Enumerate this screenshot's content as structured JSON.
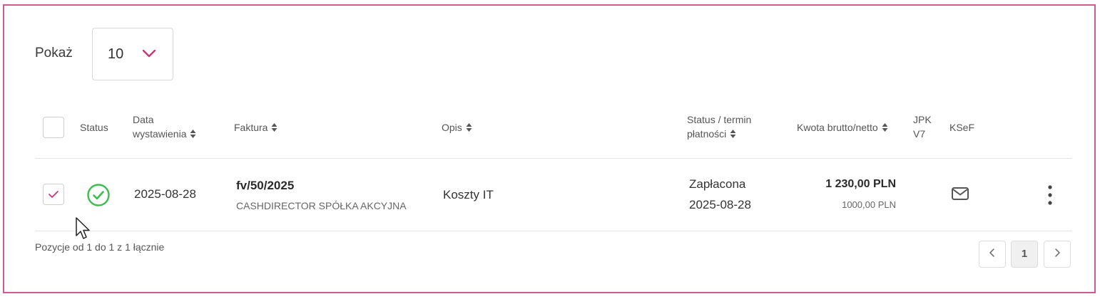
{
  "toolbar": {
    "show_label": "Pokaż",
    "page_size_value": "10"
  },
  "table": {
    "headers": {
      "status": "Status",
      "issue_date_line1": "Data",
      "issue_date_line2": "wystawienia",
      "invoice": "Faktura",
      "description": "Opis",
      "payment_status_line1": "Status / termin",
      "payment_status_line2": "płatności",
      "amount": "Kwota brutto/netto",
      "jpk_line1": "JPK",
      "jpk_line2": "V7",
      "ksef": "KSeF"
    },
    "rows": [
      {
        "checked": true,
        "status_icon": "check-circle-icon",
        "issue_date": "2025-08-28",
        "invoice_number": "fv/50/2025",
        "client": "CASHDIRECTOR SPÓŁKA AKCYJNA",
        "description": "Koszty IT",
        "payment_status": "Zapłacona",
        "payment_date": "2025-08-28",
        "amount_gross": "1 230,00 PLN",
        "amount_net": "1000,00 PLN",
        "ksef_icon": "envelope-icon",
        "actions_icon": "more-vertical-icon"
      }
    ]
  },
  "footer": {
    "summary": "Pozycje od 1 do 1 z 1 łącznie"
  },
  "pagination": {
    "prev_icon": "chevron-left-icon",
    "current_page": "1",
    "next_icon": "chevron-right-icon"
  },
  "colors": {
    "frame_accent": "#d05a93",
    "chevron_accent": "#c9357a",
    "status_ok": "#3cbf4a"
  }
}
